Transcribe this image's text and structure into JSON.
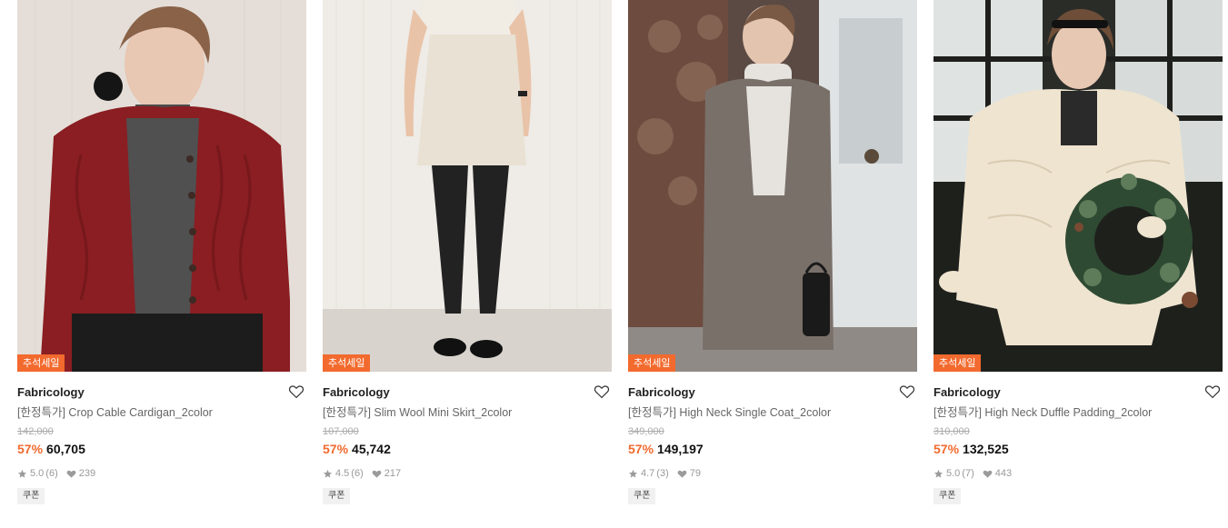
{
  "products": [
    {
      "badge": "추석세일",
      "brand": "Fabricology",
      "title": "[한정특가] Crop Cable Cardigan_2color",
      "original_price": "142,000",
      "discount": "57%",
      "price": "60,705",
      "rating": "5.0",
      "reviews": "(6)",
      "likes": "239",
      "coupon": "쿠폰",
      "image_desc": "model wearing red cable-knit cardigan",
      "colors": {
        "bg": "#e9e3dd",
        "main": "#8a1e22",
        "inner": "#4a4a4a"
      }
    },
    {
      "badge": "추석세일",
      "brand": "Fabricology",
      "title": "[한정특가] Slim Wool Mini Skirt_2color",
      "original_price": "107,000",
      "discount": "57%",
      "price": "45,742",
      "rating": "4.5",
      "reviews": "(6)",
      "likes": "217",
      "coupon": "쿠폰",
      "image_desc": "model wearing cream wool mini skirt and black tights",
      "colors": {
        "bg": "#ece7e2",
        "main": "#e8e1d4",
        "inner": "#1e1e1e"
      }
    },
    {
      "badge": "추석세일",
      "brand": "Fabricology",
      "title": "[한정특가] High Neck Single Coat_2color",
      "original_price": "349,000",
      "discount": "57%",
      "price": "149,197",
      "rating": "4.7",
      "reviews": "(3)",
      "likes": "79",
      "coupon": "쿠폰",
      "image_desc": "model wearing grey tweed long coat beside door",
      "colors": {
        "bg": "#6b5a52",
        "main": "#7a706a",
        "inner": "#e6e3de"
      }
    },
    {
      "badge": "추석세일",
      "brand": "Fabricology",
      "title": "[한정특가] High Neck Duffle Padding_2color",
      "original_price": "310,000",
      "discount": "57%",
      "price": "132,525",
      "rating": "5.0",
      "reviews": "(7)",
      "likes": "443",
      "coupon": "쿠폰",
      "image_desc": "model wearing ivory padded jacket holding wreath",
      "colors": {
        "bg": "#2c2f2a",
        "main": "#efe4d0",
        "inner": "#2f4a33"
      }
    }
  ]
}
